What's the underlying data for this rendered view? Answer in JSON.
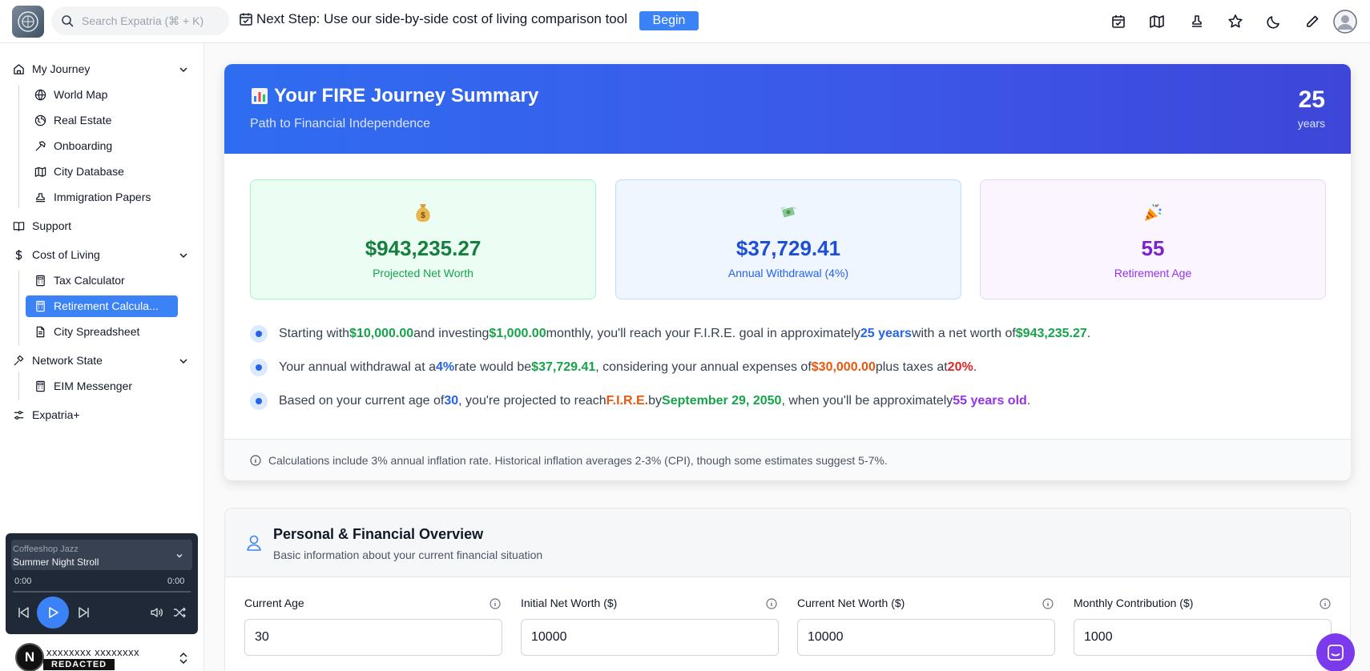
{
  "header": {
    "search_placeholder": "Search Expatria (⌘ + K)",
    "next_step_text": "Next Step: Use our side-by-side cost of living comparison tool",
    "begin_label": "Begin"
  },
  "sidebar": {
    "my_journey": "My Journey",
    "world_map": "World Map",
    "real_estate": "Real Estate",
    "onboarding": "Onboarding",
    "city_database": "City Database",
    "immigration_papers": "Immigration Papers",
    "support": "Support",
    "cost_of_living": "Cost of Living",
    "tax_calculator": "Tax Calculator",
    "retirement_calculator": "Retirement Calcula...",
    "city_spreadsheet": "City Spreadsheet",
    "network_state": "Network State",
    "eim_messenger": "EIM Messenger",
    "expatria_plus": "Expatria+"
  },
  "player": {
    "genre": "Coffeeshop Jazz",
    "track": "Summer Night Stroll",
    "time_current": "0:00",
    "time_total": "0:00"
  },
  "user": {
    "avatar_letter": "N",
    "name": "xxxxxxxx xxxxxxxx",
    "badge": "REDACTED"
  },
  "summary": {
    "title": "Your FIRE Journey Summary",
    "subtitle": "Path to Financial Independence",
    "years_value": "25",
    "years_label": "years",
    "cards": [
      {
        "value": "$943,235.27",
        "label": "Projected Net Worth"
      },
      {
        "value": "$37,729.41",
        "label": "Annual Withdrawal (4%)"
      },
      {
        "value": "55",
        "label": "Retirement Age"
      }
    ],
    "bullet1": {
      "t1": "Starting with ",
      "v1": "$10,000.00",
      "t2": " and investing ",
      "v2": "$1,000.00",
      "t3": " monthly, you'll reach your F.I.R.E. goal in approximately ",
      "v3": "25 years",
      "t4": " with a net worth of ",
      "v4": "$943,235.27",
      "t5": "."
    },
    "bullet2": {
      "t1": "Your annual withdrawal at a ",
      "v1": "4%",
      "t2": " rate would be ",
      "v2": "$37,729.41",
      "t3": ", considering your annual expenses of ",
      "v3": "$30,000.00",
      "t4": " plus taxes at ",
      "v4": "20%",
      "t5": "."
    },
    "bullet3": {
      "t1": "Based on your current age of ",
      "v1": "30",
      "t2": ", you're projected to reach ",
      "v2": "F.I.R.E.",
      "t3": " by ",
      "v3": "September 29, 2050",
      "t4": ", when you'll be approximately ",
      "v4": "55 years old",
      "t5": "."
    },
    "footnote": "Calculations include 3% annual inflation rate. Historical inflation averages 2-3% (CPI), though some estimates suggest 5-7%."
  },
  "overview": {
    "title": "Personal & Financial Overview",
    "subtitle": "Basic information about your current financial situation",
    "fields": [
      {
        "label": "Current Age",
        "value": "30"
      },
      {
        "label": "Initial Net Worth ($)",
        "value": "10000"
      },
      {
        "label": "Current Net Worth ($)",
        "value": "10000"
      },
      {
        "label": "Monthly Contribution ($)",
        "value": "1000"
      }
    ]
  },
  "colors": {
    "accent": "#3b82f6",
    "green": "#16a34a",
    "blue": "#2563eb",
    "orange": "#ea580c",
    "red": "#dc2626",
    "purple": "#9333ea"
  }
}
